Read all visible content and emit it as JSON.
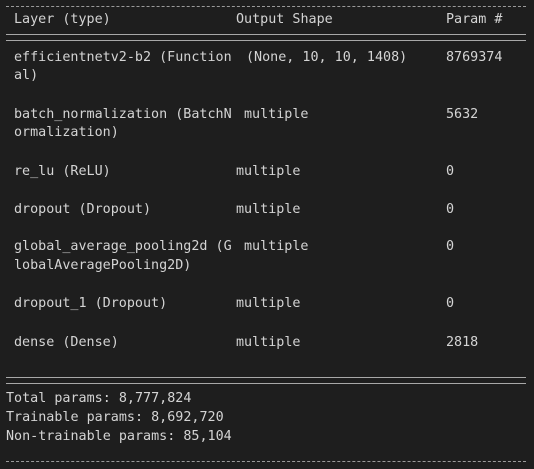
{
  "header": {
    "layer": "Layer (type)",
    "output": "Output Shape",
    "param": "Param #"
  },
  "rows": [
    {
      "layer1": "efficientnetv2-b2 (Function",
      "layer2": "al)",
      "output": "(None, 10, 10, 1408)",
      "param": "8769374"
    },
    {
      "layer1": "batch_normalization (BatchN",
      "layer2": "ormalization)",
      "output": "multiple",
      "param": "5632"
    },
    {
      "layer1": "re_lu (ReLU)",
      "layer2": "",
      "output": "multiple",
      "param": "0"
    },
    {
      "layer1": "dropout (Dropout)",
      "layer2": "",
      "output": "multiple",
      "param": "0"
    },
    {
      "layer1": "global_average_pooling2d (G",
      "layer2": "lobalAveragePooling2D)",
      "output": "multiple",
      "param": "0"
    },
    {
      "layer1": "dropout_1 (Dropout)",
      "layer2": "",
      "output": "multiple",
      "param": "0"
    },
    {
      "layer1": "dense (Dense)",
      "layer2": "",
      "output": "multiple",
      "param": "2818"
    }
  ],
  "totals": {
    "total": "Total params: 8,777,824",
    "trainable": "Trainable params: 8,692,720",
    "non_trainable": "Non-trainable params: 85,104"
  }
}
